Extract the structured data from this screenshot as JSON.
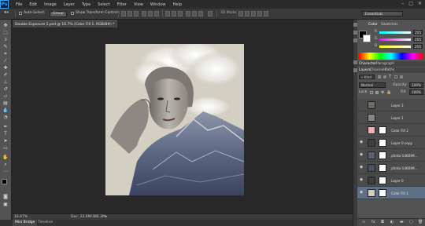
{
  "app": {
    "logo": "Ps"
  },
  "menu": [
    "File",
    "Edit",
    "Image",
    "Layer",
    "Type",
    "Select",
    "Filter",
    "View",
    "Window",
    "Help"
  ],
  "options_bar": {
    "auto_select_label": "Auto-Select:",
    "auto_select_value": "Group",
    "transform_controls_label": "Show Transform Controls",
    "workspace": "Essentials"
  },
  "document": {
    "tab_title": "Double Exposure 1.psd @ 16.7% (Color Fill 1, RGB/8#) *",
    "zoom": "16.67%",
    "doc_size": "Doc: 22.6M/386.3M"
  },
  "bottom_tabs": [
    "Mini Bridge",
    "Timeline"
  ],
  "color_panel": {
    "tabs": [
      "Color",
      "Swatches"
    ],
    "sliders": [
      {
        "channel": "R",
        "value": "255"
      },
      {
        "channel": "G",
        "value": "255"
      },
      {
        "channel": "B",
        "value": "255"
      }
    ]
  },
  "char_panel": {
    "tabs": [
      "Character",
      "Paragraph"
    ]
  },
  "layers_panel": {
    "tabs": [
      "Layers",
      "Channels",
      "Paths"
    ],
    "kind_label": "Kind",
    "blend_mode": "Normal",
    "opacity_label": "Opacity:",
    "opacity_value": "100%",
    "lock_label": "Lock:",
    "fill_label": "Fill:",
    "fill_value": "100%",
    "layers": [
      {
        "name": "Layer 2",
        "visible": false,
        "thumb_color": "#6f6a64",
        "mask": false
      },
      {
        "name": "Layer 1",
        "visible": false,
        "thumb_color": "#8a8580",
        "mask": false
      },
      {
        "name": "Color Fill 2",
        "visible": false,
        "thumb_color": "#e9b3b3",
        "mask": true
      },
      {
        "name": "Layer 0 copy",
        "visible": true,
        "thumb_color": "#404040",
        "mask": true
      },
      {
        "name": "photo-146099...",
        "visible": true,
        "thumb_color": "#5a6175",
        "mask": true
      },
      {
        "name": "photo-146099...",
        "visible": true,
        "thumb_color": "#4a5060",
        "mask": true
      },
      {
        "name": "Layer 0",
        "visible": true,
        "thumb_color": "#3d3d3d",
        "mask": true
      },
      {
        "name": "Color Fill 1",
        "visible": true,
        "thumb_color": "#d4cfc3",
        "mask": true
      }
    ]
  }
}
